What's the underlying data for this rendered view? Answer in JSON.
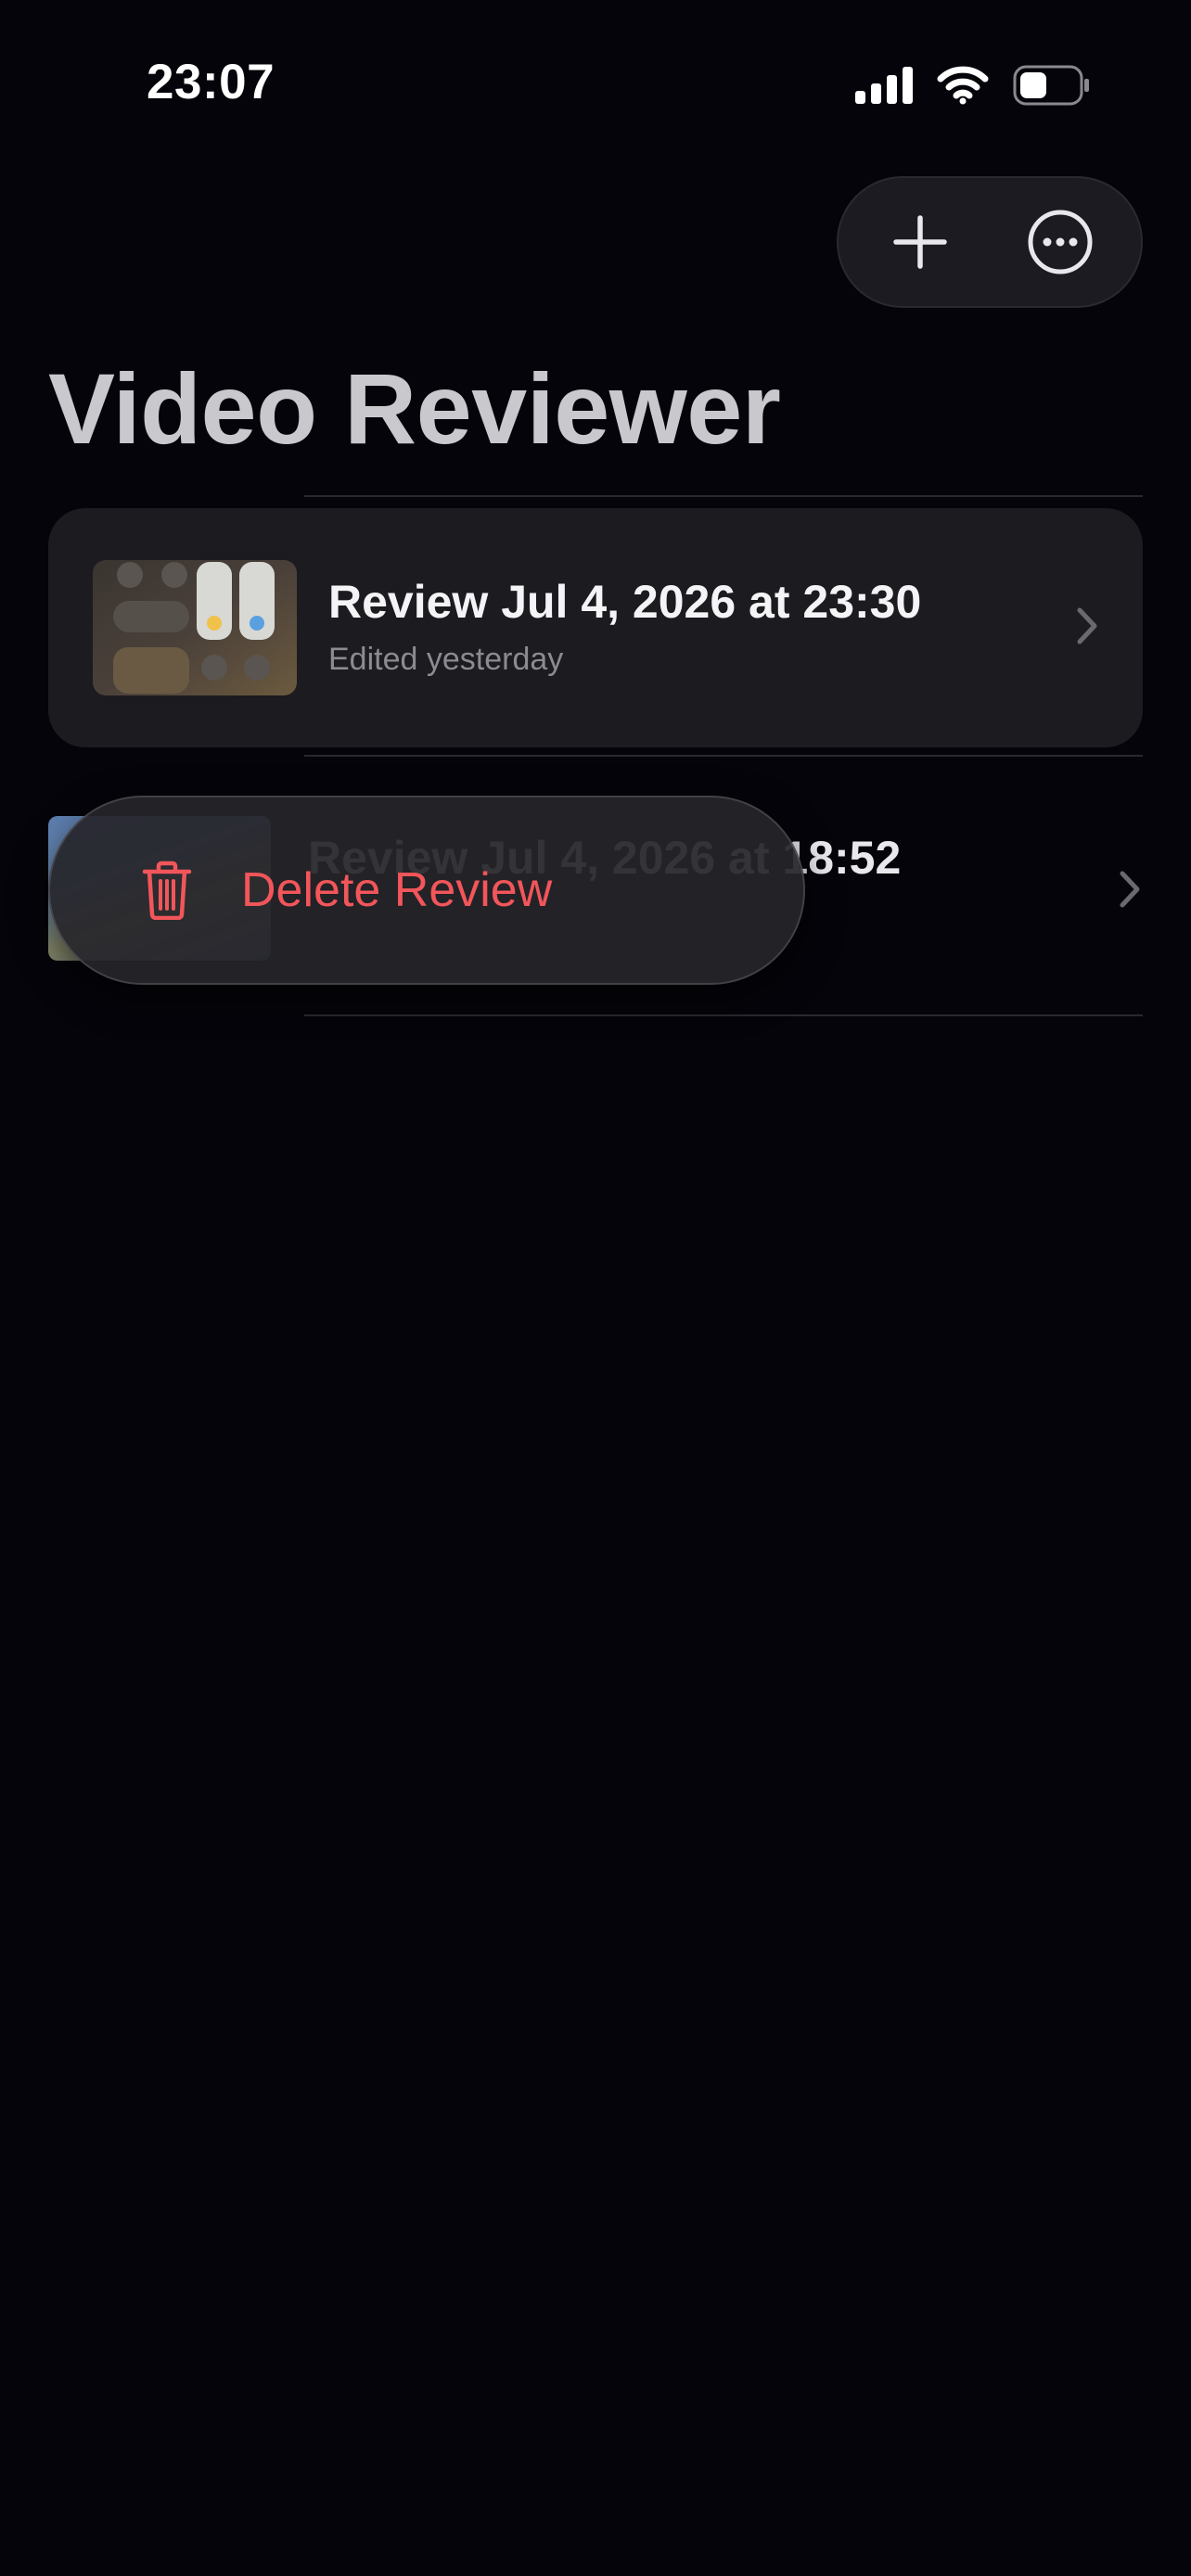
{
  "status_bar": {
    "time": "23:07"
  },
  "app": {
    "title": "Video Reviewer"
  },
  "toolbar": {
    "add_icon": "plus-icon",
    "more_icon": "ellipsis-circle-icon"
  },
  "reviews": [
    {
      "title": "Review Jul 4, 2026 at 23:30",
      "subtitle": "Edited yesterday"
    },
    {
      "title": "Review Jul 4, 2026 at 18:52"
    }
  ],
  "context_menu": {
    "delete_label": "Delete Review",
    "delete_icon": "trash-icon",
    "destructive_color": "#f2565a"
  }
}
